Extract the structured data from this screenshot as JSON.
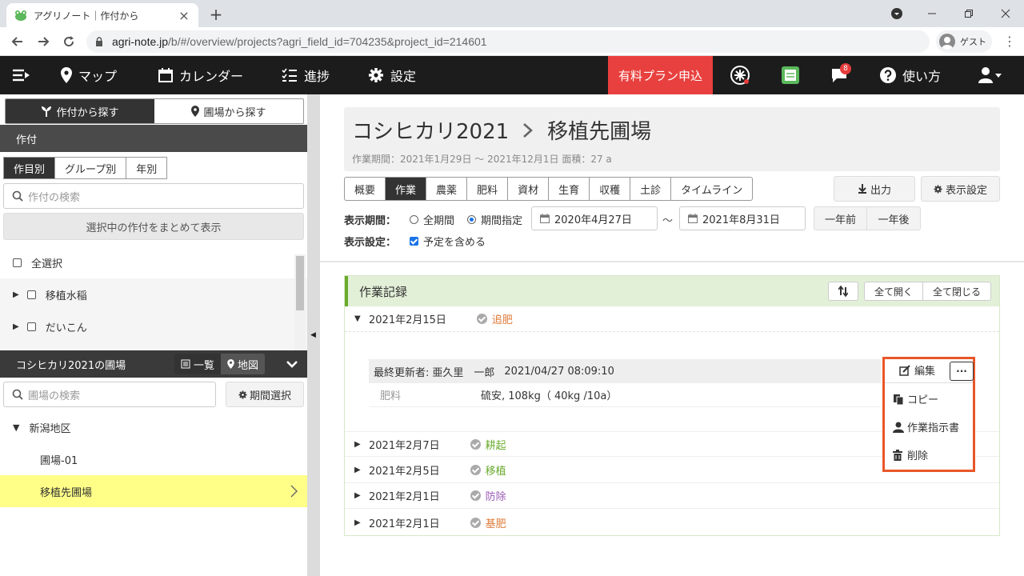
{
  "browser": {
    "tab_title": "アグリノート｜作付から",
    "tab_close": "×",
    "new_tab": "+",
    "url_host": "agri-note.jp",
    "url_path": "/b/#/overview/projects?agri_field_id=704235&project_id=214601",
    "profile_label": "ゲスト"
  },
  "appnav": {
    "map": "マップ",
    "calendar": "カレンダー",
    "progress": "進捗",
    "settings": "設定",
    "premium": "有料プラン申込",
    "notify_count": "8",
    "help": "使い方"
  },
  "sidebar": {
    "search_by_crop": "作付から探す",
    "search_by_field": "圃場から探す",
    "crop_header": "作付",
    "crop_tabs": [
      "作目別",
      "グループ別",
      "年別"
    ],
    "crop_search_placeholder": "作付の検索",
    "show_selected": "選択中の作付をまとめて表示",
    "select_all": "全選択",
    "crops": [
      "移植水稲",
      "だいこん"
    ],
    "fields_header": "コシヒカリ2021の圃場",
    "view_list": "一覧",
    "view_map": "地図",
    "field_search_placeholder": "圃場の検索",
    "period_select": "期間選択",
    "region": "新潟地区",
    "fields": [
      "圃場-01",
      "移植先圃場"
    ]
  },
  "main": {
    "crop_name": "コシヒカリ2021",
    "field_name": "移植先圃場",
    "subtitle": "作業期間：2021年1月29日 〜 2021年12月1日  面積：27 a",
    "tabs": [
      "概要",
      "作業",
      "農薬",
      "肥料",
      "資材",
      "生育",
      "収穫",
      "土診",
      "タイムライン"
    ],
    "active_tab": "作業",
    "export": "出力",
    "display_settings": "表示設定",
    "period_label": "表示期間：",
    "period_all": "全期間",
    "period_range": "期間指定",
    "date_from": "2020年4月27日",
    "date_sep": "〜",
    "date_to": "2021年8月31日",
    "prev_year": "一年前",
    "next_year": "一年後",
    "display_label": "表示設定：",
    "include_plans": "予定を含める"
  },
  "records": {
    "title": "作業記録",
    "open_all": "全て開く",
    "close_all": "全て閉じる",
    "entries": [
      {
        "date": "2021年2月15日",
        "work": "追肥",
        "color": "#e07b39"
      },
      {
        "date": "2021年2月7日",
        "work": "耕起",
        "color": "#6aaa2c"
      },
      {
        "date": "2021年2月5日",
        "work": "移植",
        "color": "#6aaa2c"
      },
      {
        "date": "2021年2月1日",
        "work": "防除",
        "color": "#9b59b6"
      },
      {
        "date": "2021年2月1日",
        "work": "基肥",
        "color": "#e07b39"
      }
    ],
    "detail": {
      "updated_by_label": "最終更新者:",
      "updated_by": "亜久里　一郎",
      "updated_at": "2021/04/27 08:09:10",
      "category": "肥料",
      "value": "硫安, 108kg（ 40kg /10a）"
    },
    "edit": "編集",
    "more": "···",
    "menu": [
      "コピー",
      "作業指示書",
      "削除"
    ]
  },
  "colors": {
    "accent_red": "#e8403e",
    "highlight_box": "#e8572a",
    "green": "#6aaa2c"
  }
}
